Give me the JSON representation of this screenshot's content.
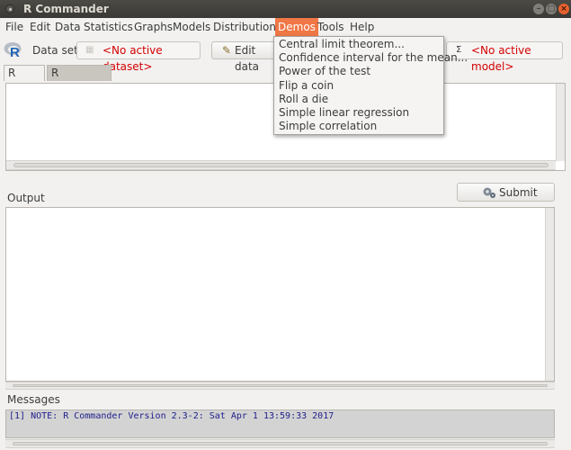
{
  "window": {
    "title": "R Commander"
  },
  "menubar": {
    "items": [
      {
        "label": "File"
      },
      {
        "label": "Edit"
      },
      {
        "label": "Data"
      },
      {
        "label": "Statistics"
      },
      {
        "label": "Graphs"
      },
      {
        "label": "Models"
      },
      {
        "label": "Distributions"
      },
      {
        "label": "Demos"
      },
      {
        "label": "Tools"
      },
      {
        "label": "Help"
      }
    ],
    "active": "Demos"
  },
  "toolbar": {
    "dataset_label": "Data set:",
    "dataset_value": "<No active dataset>",
    "edit_button": "Edit data",
    "model_value": "<No active model>",
    "model_icon": "sigma-icon"
  },
  "tabs": [
    {
      "label": "R Script"
    },
    {
      "label": "R Markdown"
    }
  ],
  "output": {
    "label": "Output",
    "submit_label": "Submit",
    "submit_icon": "gears-icon"
  },
  "messages": {
    "label": "Messages",
    "lines": [
      "[1] NOTE: R Commander Version 2.3-2: Sat Apr 1 13:59:33 2017"
    ]
  },
  "demos_menu": {
    "items": [
      {
        "label": "Central limit theorem..."
      },
      {
        "label": "Confidence interval for the mean..."
      },
      {
        "label": "Power of the test"
      },
      {
        "label": "Flip a coin"
      },
      {
        "label": "Roll a die"
      },
      {
        "label": "Simple linear regression"
      },
      {
        "label": "Simple correlation"
      }
    ]
  },
  "colors": {
    "accent": "#f07746",
    "warning_text": "#d40000",
    "message_text": "#1e1e8c"
  }
}
